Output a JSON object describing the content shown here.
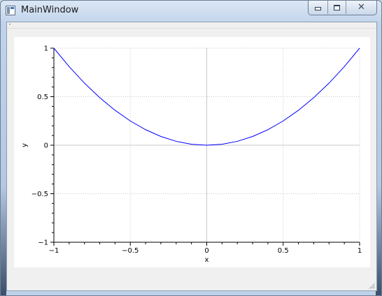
{
  "window": {
    "title": "MainWindow",
    "icon": "app-window-icon",
    "buttons": {
      "minimize_icon": "minimize-icon",
      "maximize_icon": "maximize-icon",
      "close_icon": "close-icon"
    }
  },
  "plot": {
    "accent_color": "#0000ff",
    "grid_color": "#c8c8c8"
  },
  "chart_data": {
    "type": "line",
    "title": "",
    "xlabel": "x",
    "ylabel": "y",
    "xlim": [
      -1,
      1
    ],
    "ylim": [
      -1,
      1
    ],
    "grid": true,
    "x_ticks": [
      -1,
      -0.5,
      0,
      0.5,
      1
    ],
    "x_tick_labels": [
      "−1",
      "−0.5",
      "0",
      "0.5",
      "1"
    ],
    "y_ticks": [
      -1,
      -0.5,
      0,
      0.5,
      1
    ],
    "y_tick_labels": [
      "−1",
      "−0.5",
      "0",
      "0.5",
      "1"
    ],
    "series": [
      {
        "color": "#0000ff",
        "x": [
          -1,
          -0.9,
          -0.8,
          -0.7,
          -0.6,
          -0.5,
          -0.4,
          -0.3,
          -0.2,
          -0.1,
          0,
          0.1,
          0.2,
          0.3,
          0.4,
          0.5,
          0.6,
          0.7,
          0.8,
          0.9,
          1
        ],
        "y": [
          1,
          0.81,
          0.64,
          0.49,
          0.36,
          0.25,
          0.16,
          0.09,
          0.04,
          0.01,
          0,
          0.01,
          0.04,
          0.09,
          0.16,
          0.25,
          0.36,
          0.49,
          0.64,
          0.81,
          1
        ]
      }
    ]
  }
}
